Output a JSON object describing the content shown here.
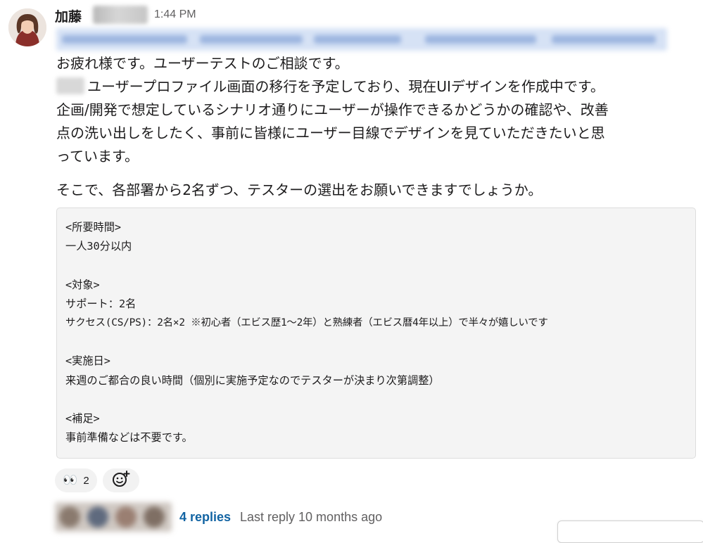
{
  "message": {
    "author_name": "加藤",
    "timestamp": "1:44 PM",
    "lines": [
      "お疲れ様です。ユーザーテストのご相談です。",
      "ユーザープロファイル画面の移行を予定しており、現在UIデザインを作成中です。",
      "企画/開発で想定しているシナリオ通りにユーザーが操作できるかどうかの確認や、改善",
      "点の洗い出しをしたく、事前に皆様にユーザー目線でデザインを見ていただきたいと思",
      "っています。"
    ],
    "request": "そこで、各部署から2名ずつ、テスターの選出をお願いできますでしょうか。",
    "code_block": {
      "line1": "<所要時間>",
      "line2": "一人30分以内",
      "line4": "<対象>",
      "line5": "サポート：2名",
      "line6": "サクセス(CS/PS)：2名×2 ※初心者（エビス歴1〜2年）と熟練者（エビス暦4年以上）で半々が嬉しいです",
      "line8": "<実施日>",
      "line9": "来週のご都合の良い時間（個別に実施予定なのでテスターが決まり次第調整）",
      "line11": "<補足>",
      "line12": "事前準備などは不要です。"
    }
  },
  "reactions": {
    "eyes": {
      "emoji": "👀",
      "count": "2"
    },
    "add_reaction_icon": "add-emoji-icon"
  },
  "thread": {
    "replies": "4 replies",
    "last_reply": "Last reply 10 months ago"
  },
  "colors": {
    "link": "#1264a3",
    "muted": "#616061",
    "code_bg": "#f4f4f4"
  }
}
